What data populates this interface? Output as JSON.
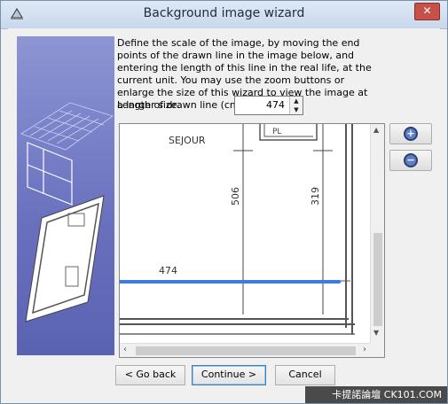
{
  "window": {
    "title": "Background image wizard",
    "close_glyph": "✕",
    "app_icon": "wizard-hat-icon"
  },
  "instructions": "Define the scale of the image, by moving the end points of the drawn line in the image below, and entering the length of this line in the real life, at the current unit. You may use the zoom buttons or enlarge the size of this wizard to view the image at a larger size.",
  "length_field": {
    "label": "Length of drawn line (cm):",
    "value": "474"
  },
  "plan": {
    "room_label": "SEJOUR",
    "dim_506": "506",
    "dim_319": "319",
    "dim_474": "474",
    "pl_label": "PL"
  },
  "zoom": {
    "in_icon": "zoom-in-icon",
    "out_icon": "zoom-out-icon",
    "plus": "+",
    "minus": "−"
  },
  "buttons": {
    "back": "< Go back",
    "continue": "Continue >",
    "cancel": "Cancel"
  },
  "watermark": "卡提諾論壇 CK101.COM",
  "colors": {
    "scale_line": "#3d7be0",
    "side_panel": "#6a72c0"
  }
}
